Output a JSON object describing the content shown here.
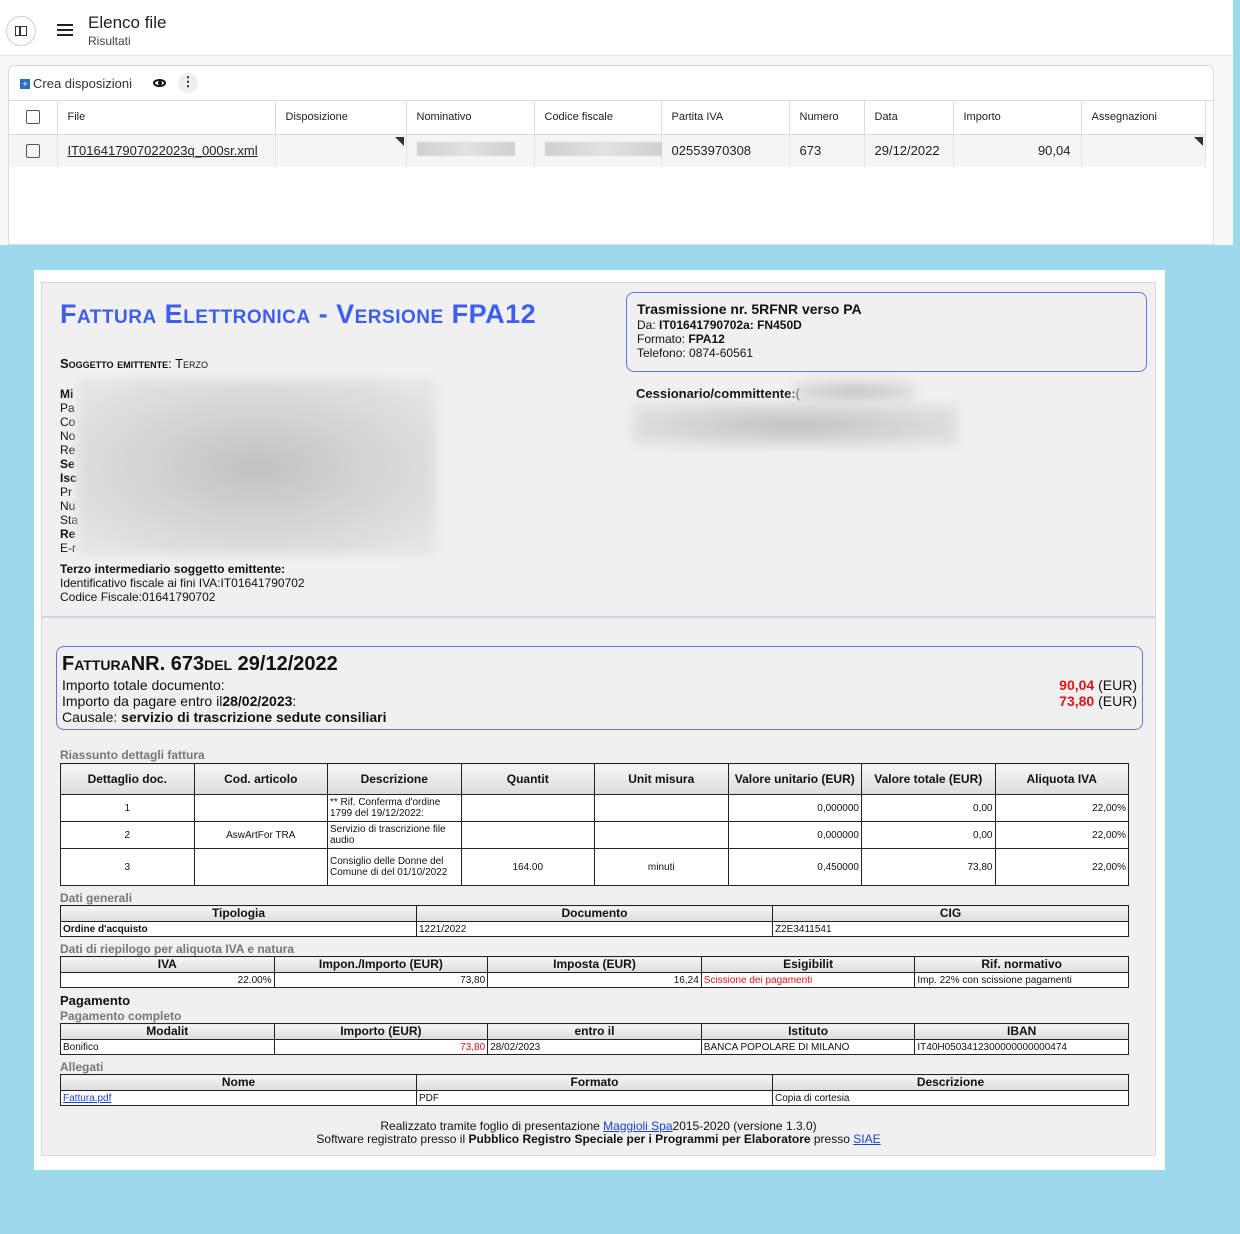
{
  "app": {
    "title": "Elenco file",
    "subtitle": "Risultati",
    "toolbar": {
      "crea_label": "Crea disposizioni",
      "more_label": "⋮"
    },
    "columns": [
      "File",
      "Disposizione",
      "Nominativo",
      "Codice fiscale",
      "Partita IVA",
      "Numero",
      "Data",
      "Importo",
      "Assegnazioni"
    ],
    "rows": [
      {
        "file": "IT016417907022023q_000sr.xml",
        "disposizione": "",
        "nominativo": "",
        "codice_fiscale": "",
        "partita_iva": "02553970308",
        "numero": "673",
        "data": "29/12/2022",
        "importo": "90,04",
        "assegnazioni": ""
      }
    ]
  },
  "invoice": {
    "title": "Fattura Elettronica - Versione FPA12",
    "soggetto_label": "Soggetto emittente",
    "soggetto_value": ": Terzo",
    "trasmissione": {
      "title": "Trasmissione nr. 5RFNR verso PA",
      "da_label": "Da: ",
      "da_value": "IT01641790702a: FN450D",
      "formato_label": "Formato: ",
      "formato_value": "FPA12",
      "telefono": "Telefono: 0874-60561"
    },
    "left_labels": [
      "Mi",
      "Pa",
      "Co",
      "No",
      "Re",
      "Se",
      "Isc",
      "Pr",
      "Nu",
      "Sta",
      "Re",
      "E-r"
    ],
    "cessionario_label": "Cessionario/committente:(",
    "terzo": {
      "heading": "Terzo intermediario soggetto emittente:",
      "line1": "Identificativo fiscale ai fini IVA:IT01641790702",
      "line2": "Codice Fiscale:01641790702"
    },
    "fattura": {
      "title": "FatturaNR. 673del 29/12/2022",
      "importo_totale_label": "Importo totale documento:",
      "importo_totale_value": "90,04",
      "currency": "(EUR)",
      "importo_pagare_label": "Importo da pagare entro il",
      "importo_pagare_date": "28/02/2023",
      "importo_pagare_colon": ":",
      "importo_pagare_value": "73,80",
      "causale_label": "Causale: ",
      "causale_value": "servizio di trascrizione sedute consiliari"
    },
    "riassunto": {
      "title": "Riassunto dettagli fattura",
      "headers": [
        "Dettaglio doc.",
        "Cod. articolo",
        "Descrizione",
        "Quantit",
        "Unit misura",
        "Valore unitario (EUR)",
        "Valore totale (EUR)",
        "Aliquota IVA"
      ],
      "rows": [
        [
          "1",
          "",
          "** Rif. Conferma d'ordine 1799 del 19/12/2022:",
          "",
          "",
          "0,000000",
          "0,00",
          "22,00%"
        ],
        [
          "2",
          "AswArtFor TRA",
          "Servizio di trascrizione file audio",
          "",
          "",
          "0,000000",
          "0,00",
          "22,00%"
        ],
        [
          "3",
          "",
          "Consiglio delle Donne del Comune di           del 01/10/2022",
          "164.00",
          "minuti",
          "0,450000",
          "73,80",
          "22,00%"
        ]
      ]
    },
    "dati_generali": {
      "title": "Dati generali",
      "headers": [
        "Tipologia",
        "Documento",
        "CIG"
      ],
      "row": [
        "Ordine d'acquisto",
        "1221/2022",
        "Z2E3411541"
      ]
    },
    "riepilogo": {
      "title": "Dati di riepilogo per aliquota IVA e natura",
      "headers": [
        "IVA",
        "Impon./Importo (EUR)",
        "Imposta (EUR)",
        "Esigibilit",
        "Rif. normativo"
      ],
      "row": [
        "22.00%",
        "73,80",
        "16,24",
        "Scissione dei pagamenti",
        "Imp. 22% con scissione pagamenti"
      ]
    },
    "pagamento": {
      "title": "Pagamento",
      "subtitle": "Pagamento completo",
      "headers": [
        "Modalit",
        "Importo (EUR)",
        "entro il",
        "Istituto",
        "IBAN"
      ],
      "row": [
        "Bonifico",
        "73,80",
        "28/02/2023",
        "BANCA POPOLARE DI MILANO",
        "IT40H0503412300000000000474"
      ]
    },
    "allegati": {
      "title": "Allegati",
      "headers": [
        "Nome",
        "Formato",
        "Descrizione"
      ],
      "row": [
        "Fattura.pdf",
        "PDF",
        "Copia di cortesia"
      ]
    },
    "footer": {
      "line1_pre": "Realizzato tramite foglio di presentazione ",
      "line1_link": "Maggioli Spa",
      "line1_post": "2015-2020 (versione 1.3.0)",
      "line2_pre": "Software registrato presso il ",
      "line2_bold": "Pubblico Registro Speciale per i Programmi per Elaboratore",
      "line2_mid": " presso ",
      "line2_link": "SIAE"
    }
  }
}
